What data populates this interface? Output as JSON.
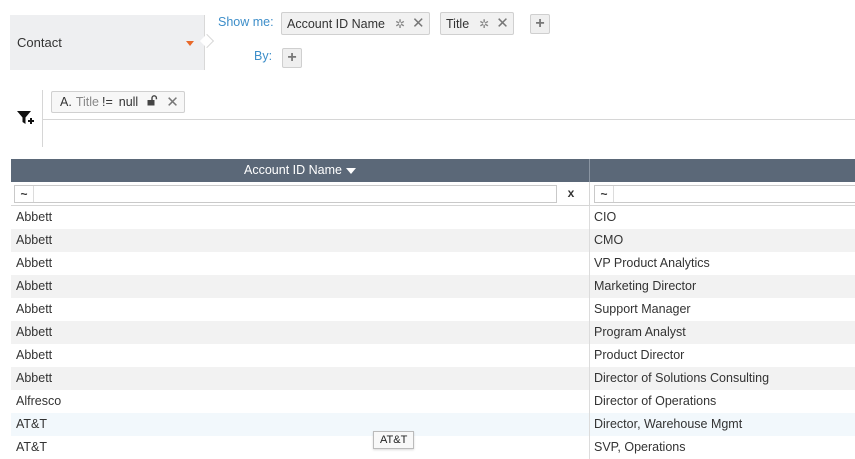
{
  "object_selector": {
    "label": "Contact",
    "accent": "#e8692a"
  },
  "show_me": {
    "label": "Show me:",
    "fields": [
      {
        "label": "Account ID Name"
      },
      {
        "label": "Title"
      }
    ]
  },
  "by": {
    "label": "By:"
  },
  "filter": {
    "prefix": "A.",
    "field": "Title",
    "operator": "!=",
    "value": "null"
  },
  "grid": {
    "header_color": "#5b6878",
    "columns": [
      {
        "label": "Account ID Name",
        "sorted": "desc"
      },
      {
        "label": ""
      }
    ],
    "filter_row": {
      "tilde": "~",
      "clear": "x",
      "value_1": "",
      "value_2": ""
    },
    "rows": [
      {
        "account": "Abbett",
        "title": "CIO"
      },
      {
        "account": "Abbett",
        "title": "CMO"
      },
      {
        "account": "Abbett",
        "title": "VP Product Analytics"
      },
      {
        "account": "Abbett",
        "title": "Marketing Director"
      },
      {
        "account": "Abbett",
        "title": "Support Manager"
      },
      {
        "account": "Abbett",
        "title": "Program Analyst"
      },
      {
        "account": "Abbett",
        "title": "Product Director"
      },
      {
        "account": "Abbett",
        "title": "Director of Solutions Consulting"
      },
      {
        "account": "Alfresco",
        "title": "Director of Operations"
      },
      {
        "account": "AT&T",
        "title": "Director, Warehouse Mgmt"
      },
      {
        "account": "AT&T",
        "title": "SVP, Operations"
      }
    ]
  },
  "tooltip": {
    "text": "AT&T"
  }
}
